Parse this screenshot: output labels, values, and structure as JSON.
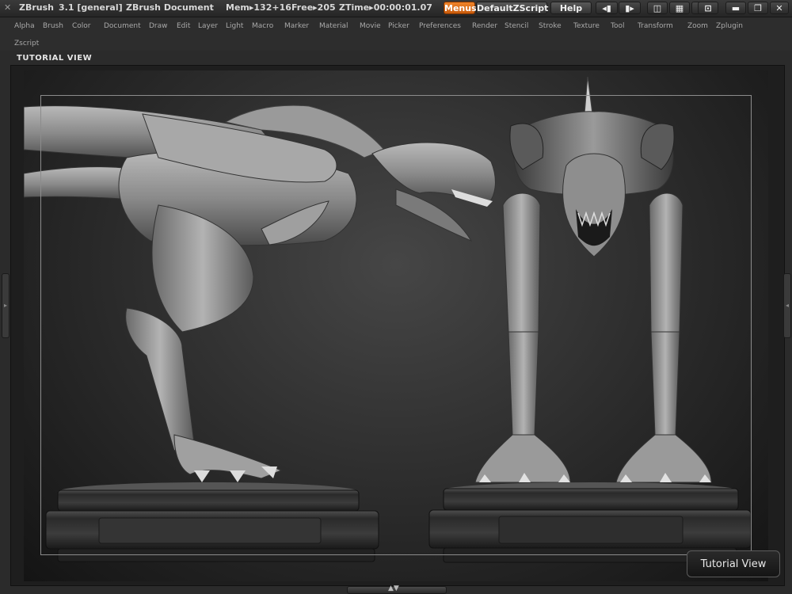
{
  "titlebar": {
    "app_name": "ZBrush",
    "version": "3.1 [general]",
    "document": "ZBrush Document",
    "mem": "Mem▸132+16",
    "free": "Free▸205",
    "ztime": "ZTime▸00:00:01.07",
    "menus_button": "Menus",
    "script_button": "DefaultZScript",
    "help_button": "Help"
  },
  "menus": [
    "Alpha",
    "Brush",
    "Color",
    "Document",
    "Draw",
    "Edit",
    "Layer",
    "Light",
    "Macro",
    "Marker",
    "Material",
    "Movie",
    "Picker",
    "Preferences",
    "Render",
    "Stencil",
    "Stroke",
    "Texture",
    "Tool",
    "Transform",
    "Zoom",
    "Zplugin",
    "Zscript"
  ],
  "view": {
    "header": "TUTORIAL VIEW",
    "tooltip": "Tutorial View"
  },
  "icons": {
    "app_logo": "zbrush-logo-icon",
    "minimize": "minimize-icon",
    "restore": "restore-icon",
    "close": "close-icon",
    "lock": "lock-icon"
  }
}
